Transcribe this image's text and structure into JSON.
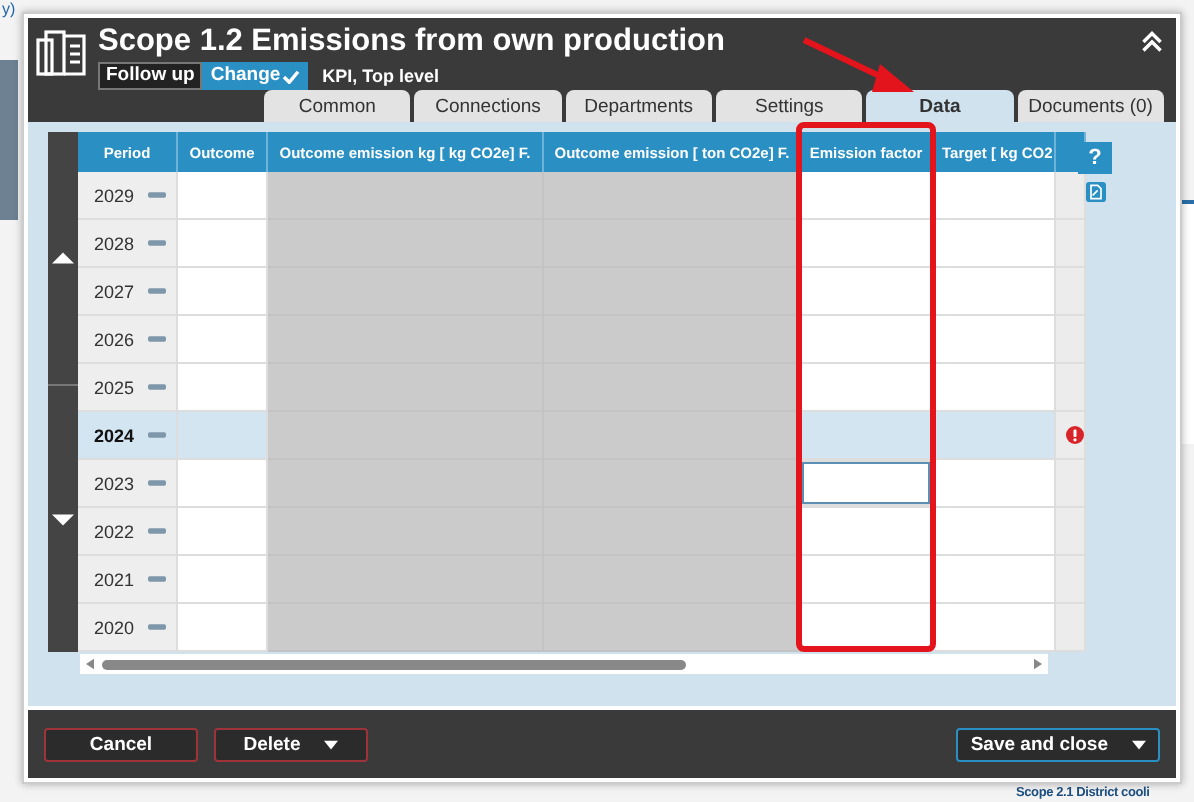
{
  "background": {
    "link_fragment": "y)",
    "item_fragment": "Scope 2.1 District cooli"
  },
  "dialog": {
    "title": "Scope 1.2 Emissions from own production",
    "follow_up": "Follow up",
    "change": "Change",
    "subtitle": "KPI, Top level"
  },
  "tabs": [
    {
      "label": "Common",
      "selected": false
    },
    {
      "label": "Connections",
      "selected": false
    },
    {
      "label": "Departments",
      "selected": false
    },
    {
      "label": "Settings",
      "selected": false
    },
    {
      "label": "Data",
      "selected": true
    },
    {
      "label": "Documents (0)",
      "selected": false
    }
  ],
  "grid": {
    "columns": [
      {
        "label": "Period",
        "kind": "period",
        "focused": false
      },
      {
        "label": "Outcome",
        "kind": "input",
        "focused": false
      },
      {
        "label": "Outcome emission kg [ kg CO2e] F.",
        "kind": "calculated",
        "focused": false
      },
      {
        "label": "Outcome emission [ ton CO2e] F.",
        "kind": "calculated",
        "focused": false
      },
      {
        "label": "Emission factor",
        "kind": "input",
        "focused": true
      },
      {
        "label": "Target [ kg CO2",
        "kind": "input",
        "focused": false
      }
    ],
    "rows": [
      {
        "period": "2029",
        "selected": false,
        "error": false,
        "focused": false
      },
      {
        "period": "2028",
        "selected": false,
        "error": false,
        "focused": false
      },
      {
        "period": "2027",
        "selected": false,
        "error": false,
        "focused": false
      },
      {
        "period": "2026",
        "selected": false,
        "error": false,
        "focused": false
      },
      {
        "period": "2025",
        "selected": false,
        "error": false,
        "focused": false
      },
      {
        "period": "2024",
        "selected": true,
        "error": true,
        "focused": false
      },
      {
        "period": "2023",
        "selected": false,
        "error": false,
        "focused": true
      },
      {
        "period": "2022",
        "selected": false,
        "error": false,
        "focused": false
      },
      {
        "period": "2021",
        "selected": false,
        "error": false,
        "focused": false
      },
      {
        "period": "2020",
        "selected": false,
        "error": false,
        "focused": false
      }
    ]
  },
  "help_button": "?",
  "buttons": [
    {
      "label": "Cancel",
      "kind": "cancel",
      "menu": false
    },
    {
      "label": "Delete",
      "kind": "cancel",
      "menu": true
    },
    {
      "label": "Save and close",
      "kind": "primary",
      "menu": true
    }
  ]
}
